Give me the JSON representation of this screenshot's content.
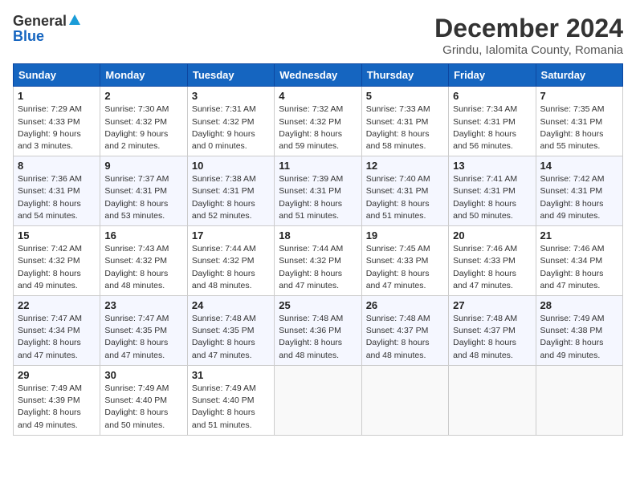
{
  "logo": {
    "general": "General",
    "blue": "Blue"
  },
  "title": "December 2024",
  "subtitle": "Grindu, Ialomita County, Romania",
  "days_header": [
    "Sunday",
    "Monday",
    "Tuesday",
    "Wednesday",
    "Thursday",
    "Friday",
    "Saturday"
  ],
  "weeks": [
    [
      {
        "day": "1",
        "sunrise": "Sunrise: 7:29 AM",
        "sunset": "Sunset: 4:33 PM",
        "daylight": "Daylight: 9 hours and 3 minutes."
      },
      {
        "day": "2",
        "sunrise": "Sunrise: 7:30 AM",
        "sunset": "Sunset: 4:32 PM",
        "daylight": "Daylight: 9 hours and 2 minutes."
      },
      {
        "day": "3",
        "sunrise": "Sunrise: 7:31 AM",
        "sunset": "Sunset: 4:32 PM",
        "daylight": "Daylight: 9 hours and 0 minutes."
      },
      {
        "day": "4",
        "sunrise": "Sunrise: 7:32 AM",
        "sunset": "Sunset: 4:32 PM",
        "daylight": "Daylight: 8 hours and 59 minutes."
      },
      {
        "day": "5",
        "sunrise": "Sunrise: 7:33 AM",
        "sunset": "Sunset: 4:31 PM",
        "daylight": "Daylight: 8 hours and 58 minutes."
      },
      {
        "day": "6",
        "sunrise": "Sunrise: 7:34 AM",
        "sunset": "Sunset: 4:31 PM",
        "daylight": "Daylight: 8 hours and 56 minutes."
      },
      {
        "day": "7",
        "sunrise": "Sunrise: 7:35 AM",
        "sunset": "Sunset: 4:31 PM",
        "daylight": "Daylight: 8 hours and 55 minutes."
      }
    ],
    [
      {
        "day": "8",
        "sunrise": "Sunrise: 7:36 AM",
        "sunset": "Sunset: 4:31 PM",
        "daylight": "Daylight: 8 hours and 54 minutes."
      },
      {
        "day": "9",
        "sunrise": "Sunrise: 7:37 AM",
        "sunset": "Sunset: 4:31 PM",
        "daylight": "Daylight: 8 hours and 53 minutes."
      },
      {
        "day": "10",
        "sunrise": "Sunrise: 7:38 AM",
        "sunset": "Sunset: 4:31 PM",
        "daylight": "Daylight: 8 hours and 52 minutes."
      },
      {
        "day": "11",
        "sunrise": "Sunrise: 7:39 AM",
        "sunset": "Sunset: 4:31 PM",
        "daylight": "Daylight: 8 hours and 51 minutes."
      },
      {
        "day": "12",
        "sunrise": "Sunrise: 7:40 AM",
        "sunset": "Sunset: 4:31 PM",
        "daylight": "Daylight: 8 hours and 51 minutes."
      },
      {
        "day": "13",
        "sunrise": "Sunrise: 7:41 AM",
        "sunset": "Sunset: 4:31 PM",
        "daylight": "Daylight: 8 hours and 50 minutes."
      },
      {
        "day": "14",
        "sunrise": "Sunrise: 7:42 AM",
        "sunset": "Sunset: 4:31 PM",
        "daylight": "Daylight: 8 hours and 49 minutes."
      }
    ],
    [
      {
        "day": "15",
        "sunrise": "Sunrise: 7:42 AM",
        "sunset": "Sunset: 4:32 PM",
        "daylight": "Daylight: 8 hours and 49 minutes."
      },
      {
        "day": "16",
        "sunrise": "Sunrise: 7:43 AM",
        "sunset": "Sunset: 4:32 PM",
        "daylight": "Daylight: 8 hours and 48 minutes."
      },
      {
        "day": "17",
        "sunrise": "Sunrise: 7:44 AM",
        "sunset": "Sunset: 4:32 PM",
        "daylight": "Daylight: 8 hours and 48 minutes."
      },
      {
        "day": "18",
        "sunrise": "Sunrise: 7:44 AM",
        "sunset": "Sunset: 4:32 PM",
        "daylight": "Daylight: 8 hours and 47 minutes."
      },
      {
        "day": "19",
        "sunrise": "Sunrise: 7:45 AM",
        "sunset": "Sunset: 4:33 PM",
        "daylight": "Daylight: 8 hours and 47 minutes."
      },
      {
        "day": "20",
        "sunrise": "Sunrise: 7:46 AM",
        "sunset": "Sunset: 4:33 PM",
        "daylight": "Daylight: 8 hours and 47 minutes."
      },
      {
        "day": "21",
        "sunrise": "Sunrise: 7:46 AM",
        "sunset": "Sunset: 4:34 PM",
        "daylight": "Daylight: 8 hours and 47 minutes."
      }
    ],
    [
      {
        "day": "22",
        "sunrise": "Sunrise: 7:47 AM",
        "sunset": "Sunset: 4:34 PM",
        "daylight": "Daylight: 8 hours and 47 minutes."
      },
      {
        "day": "23",
        "sunrise": "Sunrise: 7:47 AM",
        "sunset": "Sunset: 4:35 PM",
        "daylight": "Daylight: 8 hours and 47 minutes."
      },
      {
        "day": "24",
        "sunrise": "Sunrise: 7:48 AM",
        "sunset": "Sunset: 4:35 PM",
        "daylight": "Daylight: 8 hours and 47 minutes."
      },
      {
        "day": "25",
        "sunrise": "Sunrise: 7:48 AM",
        "sunset": "Sunset: 4:36 PM",
        "daylight": "Daylight: 8 hours and 48 minutes."
      },
      {
        "day": "26",
        "sunrise": "Sunrise: 7:48 AM",
        "sunset": "Sunset: 4:37 PM",
        "daylight": "Daylight: 8 hours and 48 minutes."
      },
      {
        "day": "27",
        "sunrise": "Sunrise: 7:48 AM",
        "sunset": "Sunset: 4:37 PM",
        "daylight": "Daylight: 8 hours and 48 minutes."
      },
      {
        "day": "28",
        "sunrise": "Sunrise: 7:49 AM",
        "sunset": "Sunset: 4:38 PM",
        "daylight": "Daylight: 8 hours and 49 minutes."
      }
    ],
    [
      {
        "day": "29",
        "sunrise": "Sunrise: 7:49 AM",
        "sunset": "Sunset: 4:39 PM",
        "daylight": "Daylight: 8 hours and 49 minutes."
      },
      {
        "day": "30",
        "sunrise": "Sunrise: 7:49 AM",
        "sunset": "Sunset: 4:40 PM",
        "daylight": "Daylight: 8 hours and 50 minutes."
      },
      {
        "day": "31",
        "sunrise": "Sunrise: 7:49 AM",
        "sunset": "Sunset: 4:40 PM",
        "daylight": "Daylight: 8 hours and 51 minutes."
      },
      null,
      null,
      null,
      null
    ]
  ]
}
